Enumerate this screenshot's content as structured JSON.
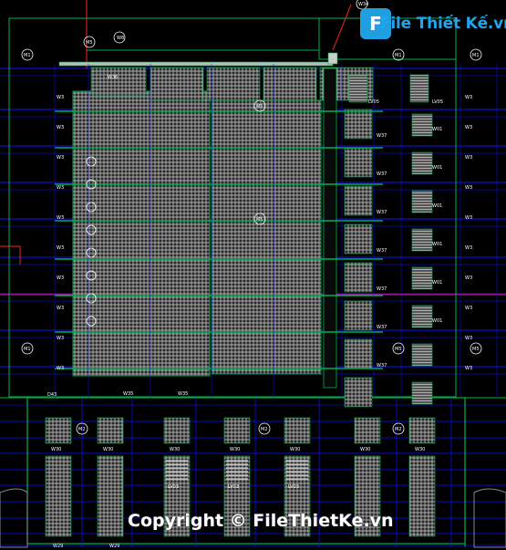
{
  "watermark": {
    "logo_text": "File Thiết Kế.vn",
    "logo_badge": "F",
    "copyright": "Copyright © FileThietKe.vn"
  },
  "labels": {
    "top_marker": "W34",
    "roof_marker": "W8",
    "lv_upper_a": "LV05",
    "lv_upper_b": "LV05",
    "lv_lower": [
      "LV03",
      "LV03",
      "LV03"
    ],
    "podium_windows": [
      "W30",
      "W30",
      "W30",
      "W30",
      "W30",
      "W30",
      "W30"
    ],
    "bottom_left": [
      "W29",
      "W29"
    ],
    "right_column_a": [
      "W37",
      "W37",
      "W37",
      "W37",
      "W37",
      "W37",
      "W37"
    ],
    "right_column_b": [
      "W01",
      "W01",
      "W01",
      "W01",
      "W01",
      "W01"
    ],
    "edge_right": [
      "W3",
      "W3",
      "W3",
      "W3",
      "W3",
      "W3",
      "W3",
      "W3",
      "W3",
      "W3"
    ],
    "edge_left": [
      "W3",
      "W3",
      "W3",
      "W3",
      "W3",
      "W3",
      "W3",
      "W3",
      "W3",
      "W3"
    ],
    "roof_left": "W36",
    "podium_left": "D43",
    "podium_mid": [
      "W35",
      "W35"
    ],
    "callouts": [
      "M1",
      "M1",
      "M1",
      "M1",
      "M5",
      "M5",
      "M5",
      "M5",
      "M5",
      "M2",
      "M2",
      "M2"
    ]
  },
  "colors": {
    "background": "#000000",
    "outline": "#00b050",
    "grid": "#1010ff",
    "hatch": "#d8d8d8",
    "accent_red": "#ff2020",
    "text": "#ffffff"
  }
}
